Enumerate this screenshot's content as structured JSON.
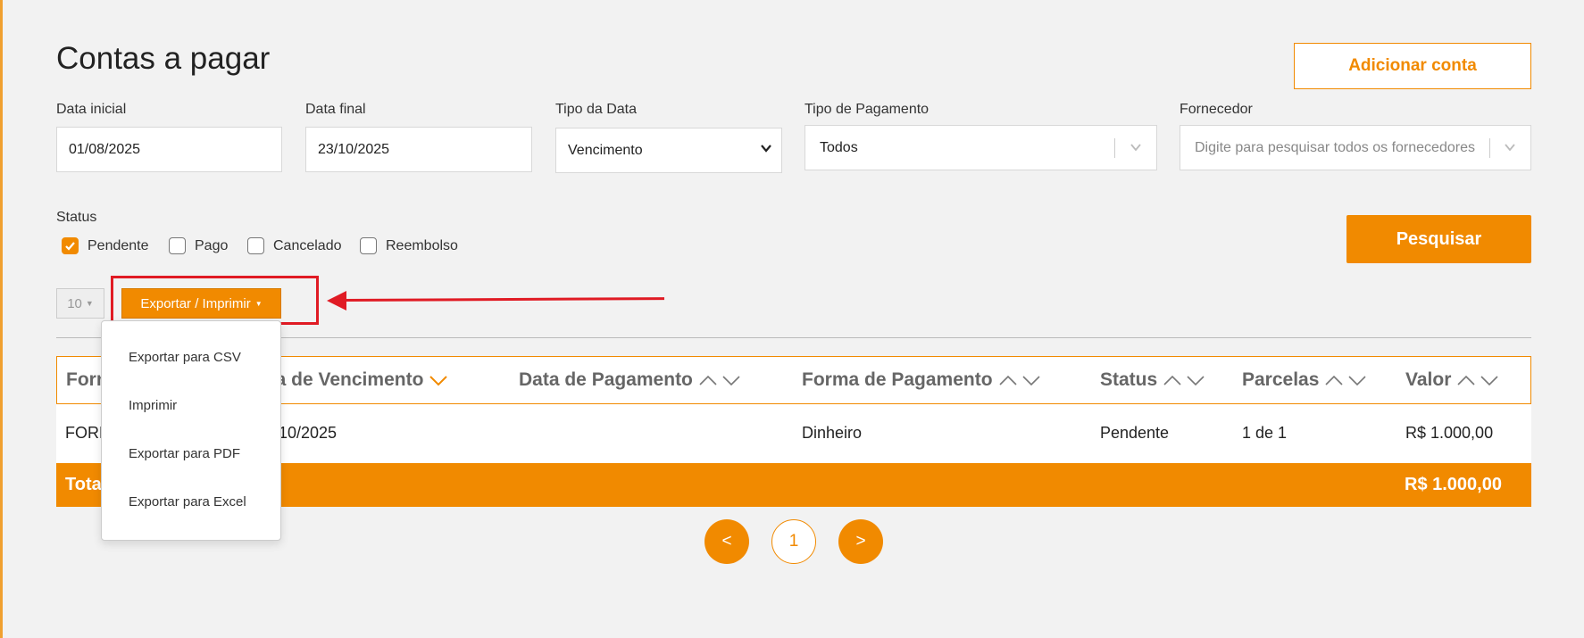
{
  "page": {
    "title": "Contas a pagar",
    "add_button": "Adicionar conta"
  },
  "filters": {
    "data_inicial": {
      "label": "Data inicial",
      "value": "01/08/2025"
    },
    "data_final": {
      "label": "Data final",
      "value": "23/10/2025"
    },
    "tipo_data": {
      "label": "Tipo da Data",
      "value": "Vencimento"
    },
    "tipo_pagamento": {
      "label": "Tipo de Pagamento",
      "value": "Todos"
    },
    "fornecedor": {
      "label": "Fornecedor",
      "placeholder": "Digite para pesquisar todos os fornecedores"
    }
  },
  "status": {
    "label": "Status",
    "options": [
      {
        "label": "Pendente",
        "checked": true
      },
      {
        "label": "Pago",
        "checked": false
      },
      {
        "label": "Cancelado",
        "checked": false
      },
      {
        "label": "Reembolso",
        "checked": false
      }
    ]
  },
  "search_button": "Pesquisar",
  "toolbar": {
    "page_size": "10",
    "export_label": "Exportar / Imprimir"
  },
  "dropdown": {
    "items": [
      "Exportar para CSV",
      "Imprimir",
      "Exportar para PDF",
      "Exportar para Excel"
    ]
  },
  "table": {
    "columns": {
      "fornecedor": "Forn",
      "vencimento": "ata de Vencimento",
      "pagamento": "Data de Pagamento",
      "forma": "Forma de Pagamento",
      "status": "Status",
      "parcelas": "Parcelas",
      "valor": "Valor"
    },
    "rows": [
      {
        "fornecedor": "FORN",
        "vencimento": "/10/2025",
        "pagamento": "",
        "forma": "Dinheiro",
        "status": "Pendente",
        "parcelas": "1 de 1",
        "valor": "R$ 1.000,00"
      }
    ],
    "total": {
      "label": "Tota",
      "value": "R$ 1.000,00"
    }
  },
  "pagination": {
    "prev": "<",
    "current": "1",
    "next": ">"
  },
  "colors": {
    "accent": "#f18a00",
    "annotation": "#e01b24"
  }
}
